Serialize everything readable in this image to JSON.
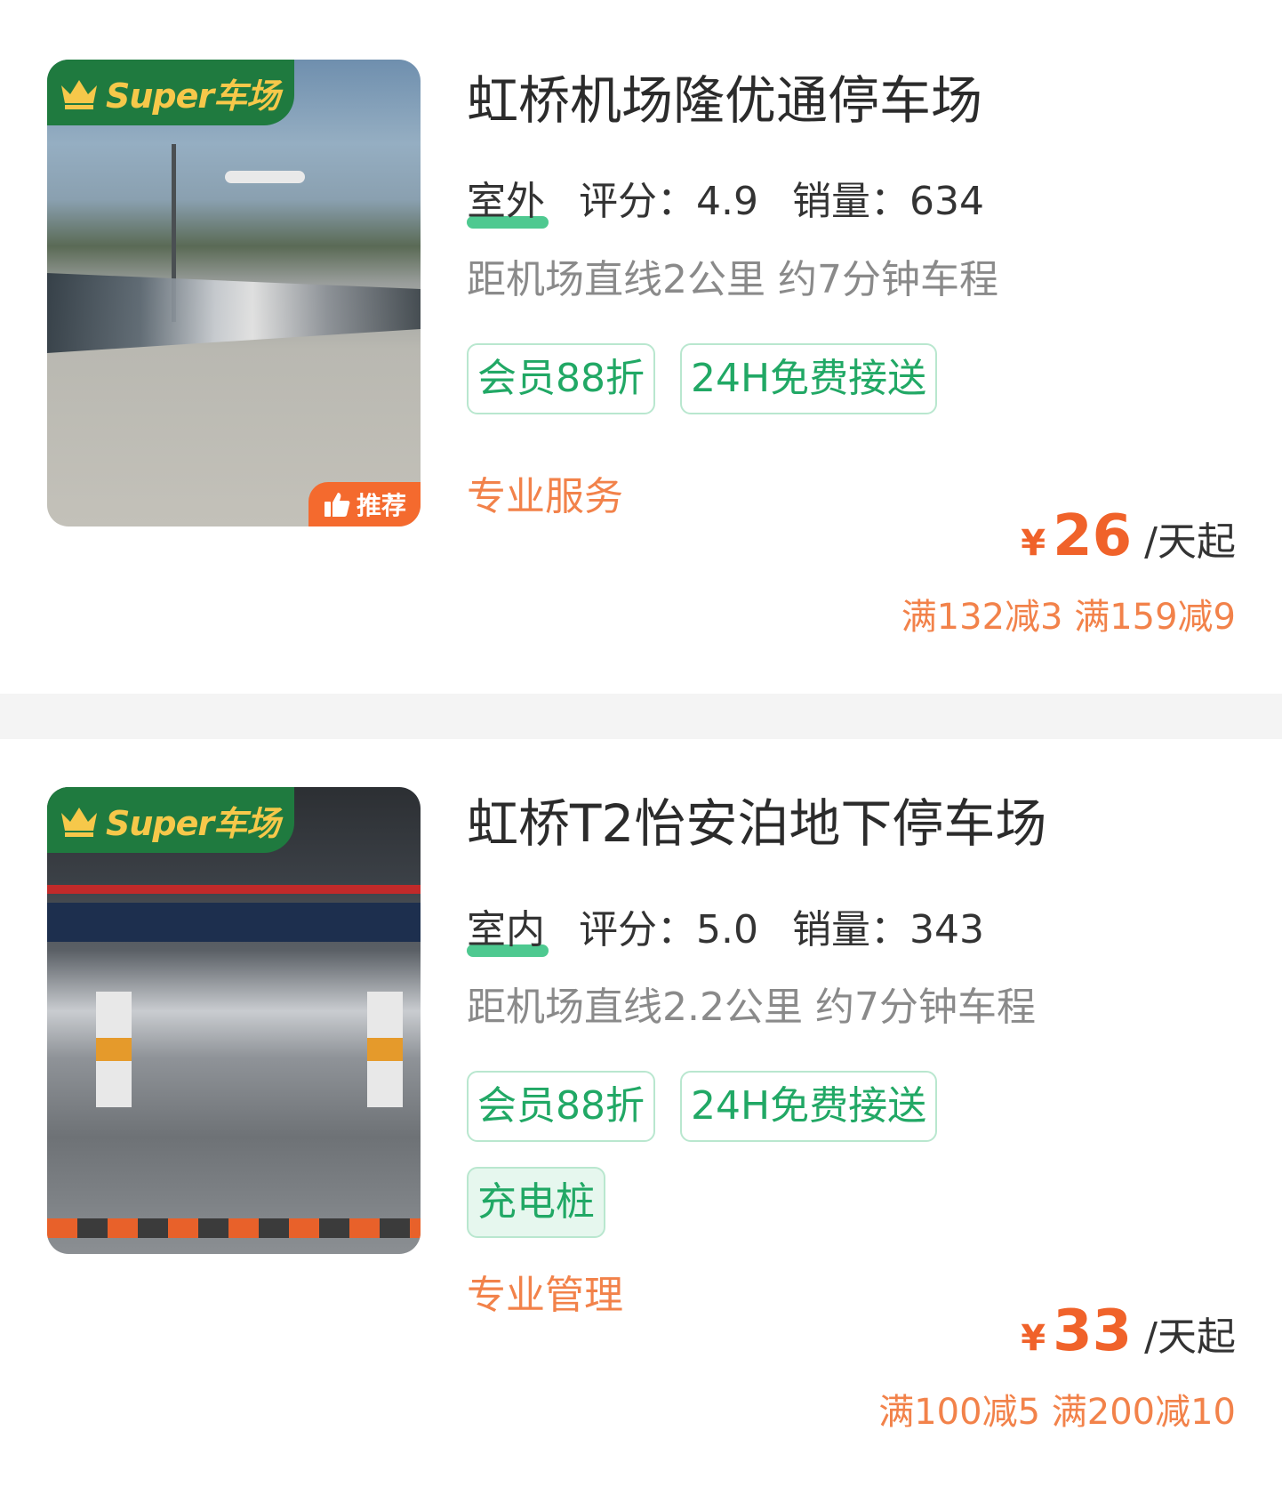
{
  "listings": [
    {
      "badge": "Super车场",
      "recommend": "推荐",
      "title": "虹桥机场隆优通停车场",
      "env": "室外",
      "rating": "评分：4.9",
      "sales": "销量：634",
      "distance": "距机场直线2公里 约7分钟车程",
      "tags": [
        "会员88折",
        "24H免费接送"
      ],
      "service": "专业服务",
      "currency": "¥",
      "price": "26",
      "unit": "/天起",
      "discount": "满132减3 满159减9"
    },
    {
      "badge": "Super车场",
      "title": "虹桥T2怡安泊地下停车场",
      "env": "室内",
      "rating": "评分：5.0",
      "sales": "销量：343",
      "distance": "距机场直线2.2公里 约7分钟车程",
      "tags": [
        "会员88折",
        "24H免费接送",
        "充电桩"
      ],
      "service": "专业管理",
      "currency": "¥",
      "price": "33",
      "unit": "/天起",
      "discount": "满100减5 满200减10"
    }
  ],
  "colors": {
    "brand_green": "#1f7a3f",
    "badge_gold": "#f6c84a",
    "tag_green": "#21a865",
    "price_orange": "#f0622a",
    "accent_orange": "#f2824a"
  },
  "icons": {
    "crown": "crown-icon",
    "thumbs_up": "thumbs-up-icon"
  }
}
